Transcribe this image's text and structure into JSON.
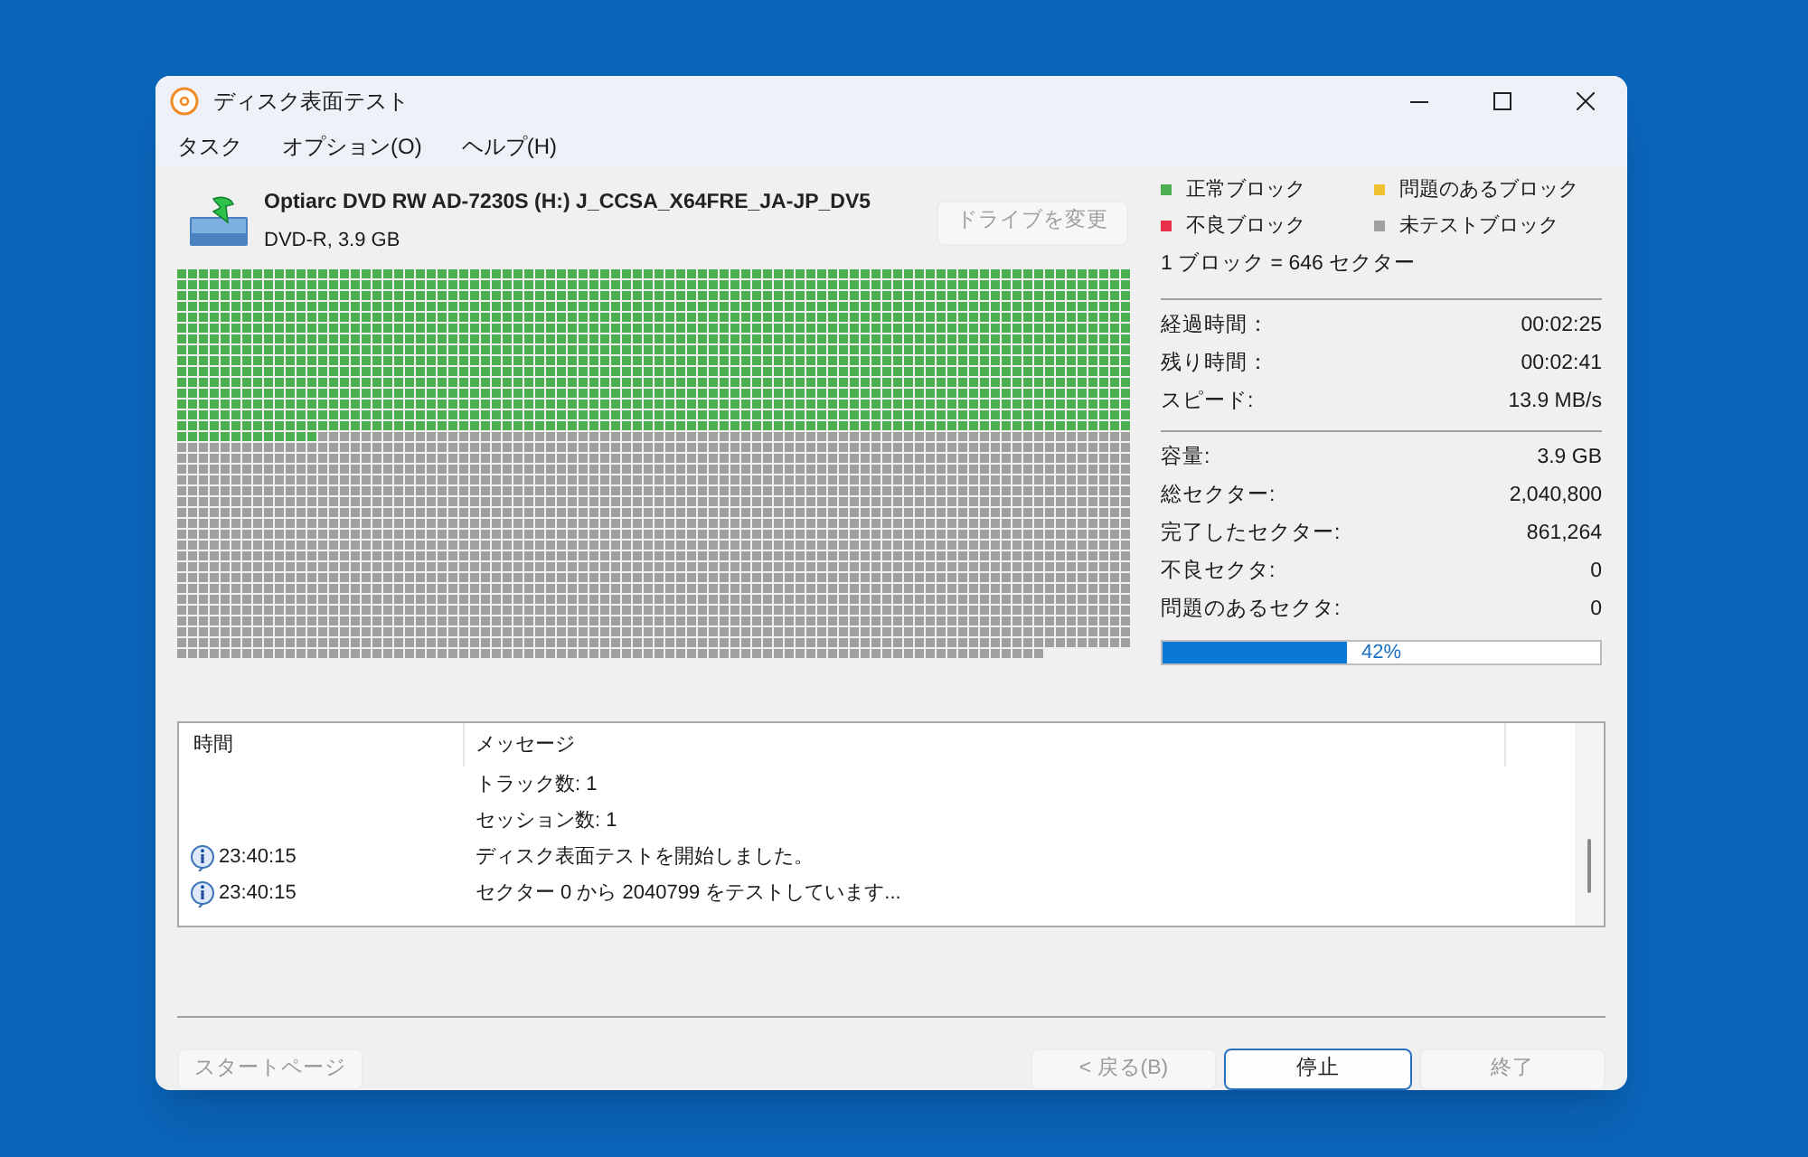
{
  "window": {
    "title": "ディスク表面テスト"
  },
  "menu": [
    "タスク",
    "オプション(O)",
    "ヘルプ(H)"
  ],
  "drive": {
    "name": "Optiarc DVD RW AD-7230S (H:) J_CCSA_X64FRE_JA-JP_DV5",
    "details": "DVD-R, 3.9 GB",
    "change_button": {
      "label": "ドライブを変更",
      "disabled": true
    }
  },
  "legend": [
    {
      "label": "正常ブロック",
      "color": "#4caf50"
    },
    {
      "label": "問題のあるブロック",
      "color": "#f0c030"
    },
    {
      "label": "不良ブロック",
      "color": "#e8304a"
    },
    {
      "label": "未テストブロック",
      "color": "#a0a0a0"
    }
  ],
  "block_size": "1 ブロック = 646 セクター",
  "time_stats": [
    {
      "label": "経過時間：",
      "value": "00:02:25"
    },
    {
      "label": "残り時間：",
      "value": "00:02:41"
    },
    {
      "label": "スピード:",
      "value": "13.9 MB/s"
    }
  ],
  "sector_stats": [
    {
      "label": "容量:",
      "value": "3.9 GB"
    },
    {
      "label": "総セクター:",
      "value": "2,040,800"
    },
    {
      "label": "完了したセクター:",
      "value": "861,264"
    },
    {
      "label": "不良セクタ:",
      "value": "0"
    },
    {
      "label": "問題のあるセクタ:",
      "value": "0"
    }
  ],
  "progress": {
    "level": 0.42,
    "label": "42%"
  },
  "log": {
    "columns": [
      "時間",
      "メッセージ"
    ],
    "rows": [
      {
        "kind": "plain",
        "message": "トラック数: 1"
      },
      {
        "kind": "plain",
        "message": "セッション数: 1"
      },
      {
        "kind": "info",
        "time": "23:40:15",
        "message": "ディスク表面テストを開始しました。"
      },
      {
        "kind": "info",
        "time": "23:40:15",
        "message": "セクター 0 から 2040799 をテストしています..."
      }
    ]
  },
  "buttons": [
    {
      "label": "スタートページ",
      "disabled": true,
      "default": false
    },
    {
      "label": "< 戻る(B)",
      "disabled": true,
      "default": false
    },
    {
      "label": "停止",
      "disabled": false,
      "default": true
    },
    {
      "label": "終了",
      "disabled": true,
      "default": false
    }
  ]
}
